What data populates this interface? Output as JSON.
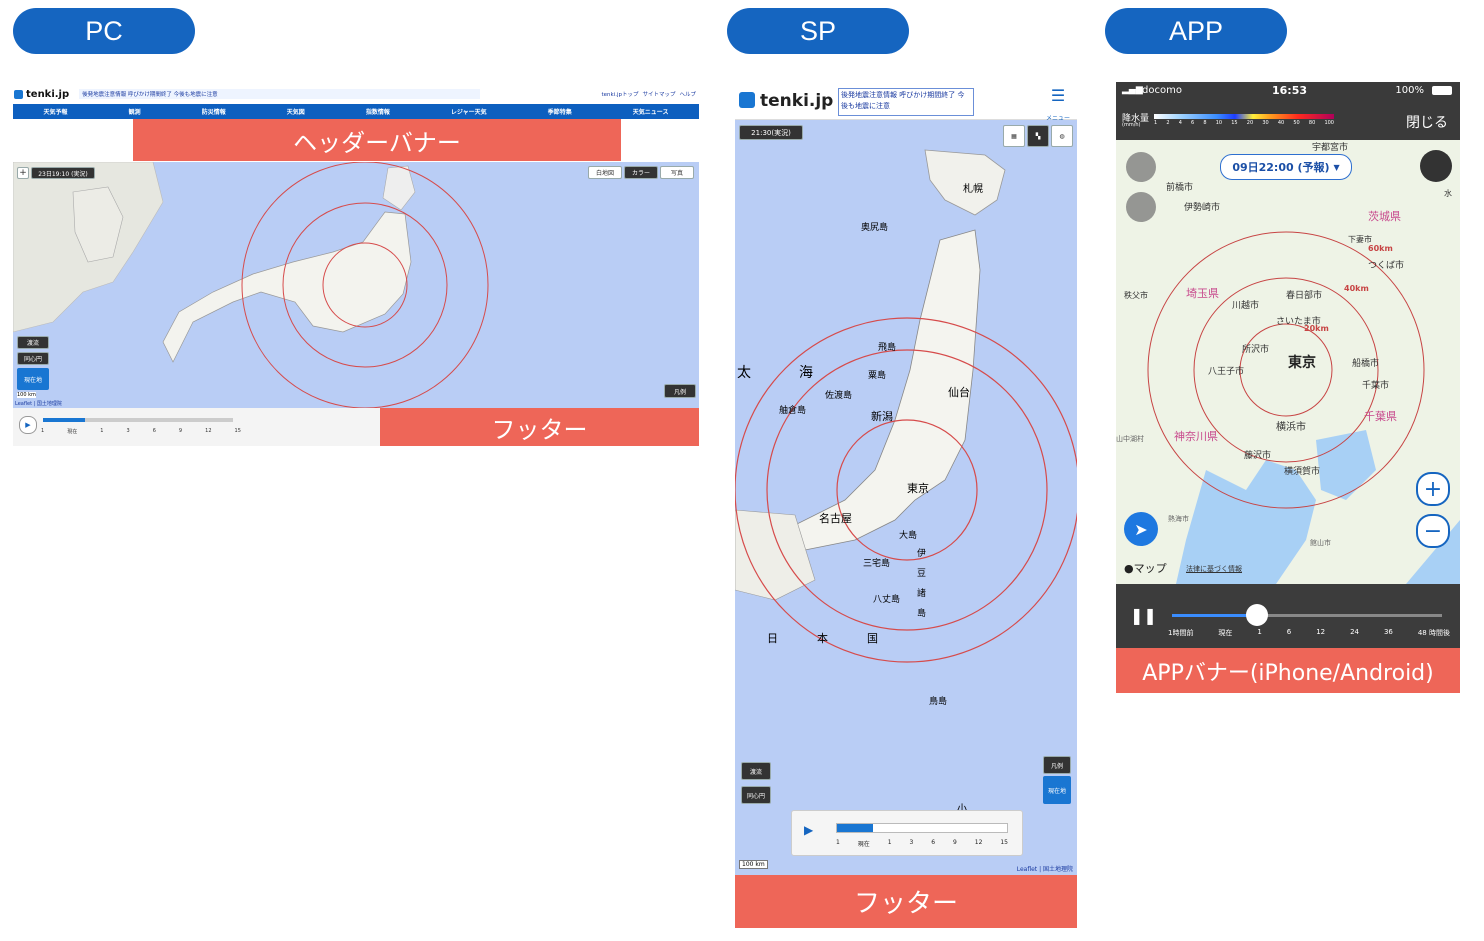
{
  "labels": {
    "pc": "PC",
    "sp": "SP",
    "app": "APP"
  },
  "pc": {
    "logo": "tenki.jp",
    "alert": "後発地震注意情報 呼びかけ期間終了 今後も地震に注意",
    "toplinks": [
      "tenki.jpトップ",
      "サイトマップ",
      "ヘルプ"
    ],
    "nav": [
      "天気予報",
      "観測",
      "防災情報",
      "天気図",
      "指数情報",
      "レジャー天気",
      "季節特集",
      "天気ニュース"
    ],
    "header_banner": "ヘッダーバナー",
    "timestamp": "23日19:10 (実況)",
    "map_buttons": [
      "白地図",
      "カラー",
      "写真"
    ],
    "side_buttons": [
      "渡流",
      "同心円",
      "現在地"
    ],
    "legend": "凡例",
    "scale": "100 km",
    "attribution": "Leaflet | 国土地理院",
    "timeline_ticks": [
      "1",
      "現在",
      "1",
      "3",
      "6",
      "9",
      "12",
      "15"
    ],
    "footer": "フッター"
  },
  "sp": {
    "logo": "tenki.jp",
    "alert": "後発地震注意情報 呼びかけ期間終了 今後も地震に注意",
    "menu": "メニュー",
    "timestamp": "21:30(実況)",
    "map_place_labels": [
      "札幌",
      "奥尻島",
      "飛島",
      "粟島",
      "佐渡島",
      "舳倉島",
      "新潟",
      "仙台",
      "東京",
      "大島",
      "三宅島",
      "八丈島",
      "伊",
      "豆",
      "諸",
      "島",
      "名古屋",
      "鳥島",
      "海",
      "太",
      "日",
      "本",
      "国",
      "小"
    ],
    "side_buttons": [
      "渡流",
      "同心円"
    ],
    "right_buttons": [
      "凡例",
      "現在地"
    ],
    "timeline_ticks": [
      "1",
      "現在",
      "1",
      "3",
      "6",
      "9",
      "12",
      "15"
    ],
    "scale": "100 km",
    "attribution": "Leaflet | 国土地理院",
    "footer": "フッター"
  },
  "app": {
    "carrier": "docomo",
    "time": "16:53",
    "battery": "100%",
    "rain_label": "降水量",
    "rain_unit": "(mm/h)",
    "rain_scale": [
      "1",
      "2",
      "4",
      "6",
      "8",
      "10",
      "15",
      "20",
      "30",
      "40",
      "50",
      "80",
      "100"
    ],
    "close": "閉じる",
    "datetime": "09日22:00 (予報)",
    "places": [
      "前橋市",
      "伊勢崎市",
      "茨城県",
      "下妻市",
      "つくば市",
      "埼玉県",
      "秩父市",
      "川越市",
      "春日部市",
      "さいたま市",
      "所沢市",
      "八王子市",
      "東京",
      "船橋市",
      "千葉市",
      "千葉県",
      "神奈川県",
      "横浜市",
      "藤沢市",
      "横須賀市",
      "宇都宮市",
      "熱海市",
      "館山市",
      "山中湖村",
      "水"
    ],
    "rings": [
      "20km",
      "40km",
      "60km"
    ],
    "map_credit": "マップ",
    "legal": "法律に基づく情報",
    "timeline_ticks": [
      "1時間前",
      "現在",
      "1",
      "6",
      "12",
      "24",
      "36",
      "48 時間後"
    ],
    "banner": "APPバナー(iPhone/Android)",
    "colors": {
      "accent": "#1565c0",
      "banner": "#ee6658",
      "map": "#b9cdf5"
    }
  }
}
